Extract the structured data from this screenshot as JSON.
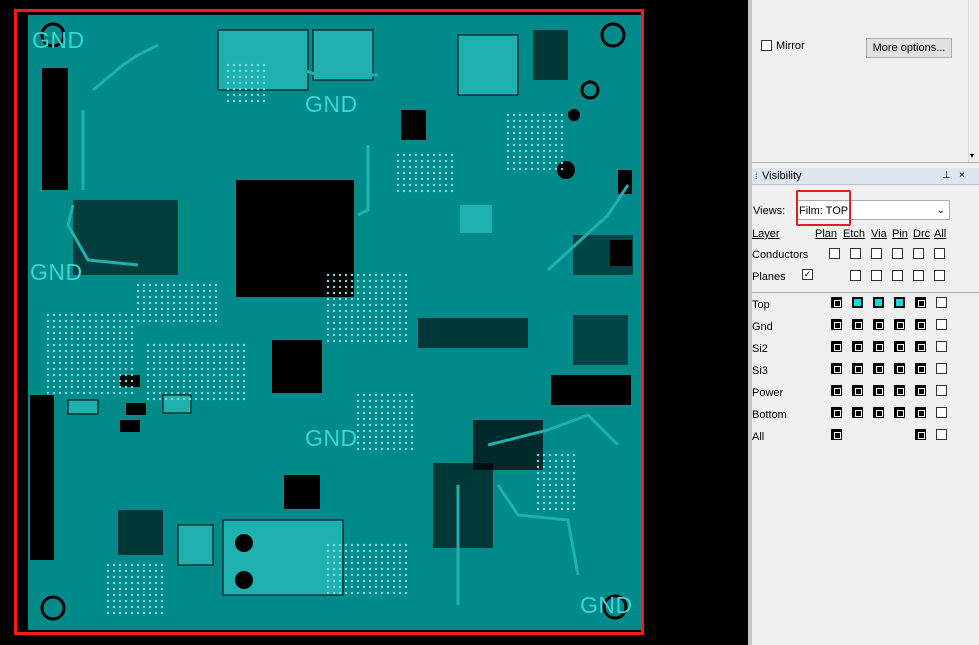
{
  "board": {
    "gnd_labels": [
      "GND",
      "GND",
      "GND",
      "GND",
      "GND"
    ],
    "colors": {
      "board": "#008a8a",
      "copper": "#000000",
      "trace": "#1fb0b0",
      "highlight": "#ff1a1a",
      "label": "#38d6d6"
    }
  },
  "panel": {
    "mirror_label": "Mirror",
    "more_options_label": "More options...",
    "visibility_title": "Visibility",
    "views_label": "Views:",
    "views_value": "Film: TOP",
    "columns": [
      "Layer",
      "Plan",
      "Etch",
      "Via",
      "Pin",
      "Drc",
      "All"
    ],
    "global_rows": [
      {
        "label": "Conductors",
        "cells": [
          "wht",
          "wht",
          "wht",
          "wht",
          "wht",
          "wht"
        ]
      },
      {
        "label": "Planes",
        "checked": true,
        "cells": [
          "wht",
          "wht",
          "wht",
          "wht",
          "wht"
        ]
      }
    ],
    "layers": [
      {
        "label": "Top",
        "cells": [
          "blk",
          "cyan",
          "cyan",
          "cyan",
          "blk",
          "wht"
        ]
      },
      {
        "label": "Gnd",
        "cells": [
          "blk",
          "blk",
          "blk",
          "blk",
          "blk",
          "wht"
        ]
      },
      {
        "label": "Si2",
        "cells": [
          "blk",
          "blk",
          "blk",
          "blk",
          "blk",
          "wht"
        ]
      },
      {
        "label": "Si3",
        "cells": [
          "blk",
          "blk",
          "blk",
          "blk",
          "blk",
          "wht"
        ]
      },
      {
        "label": "Power",
        "cells": [
          "blk",
          "blk",
          "blk",
          "blk",
          "blk",
          "wht"
        ]
      },
      {
        "label": "Bottom",
        "cells": [
          "blk",
          "blk",
          "blk",
          "blk",
          "blk",
          "wht"
        ]
      },
      {
        "label": "All",
        "cells": [
          "blk",
          null,
          null,
          null,
          "blk",
          "wht"
        ]
      }
    ]
  }
}
